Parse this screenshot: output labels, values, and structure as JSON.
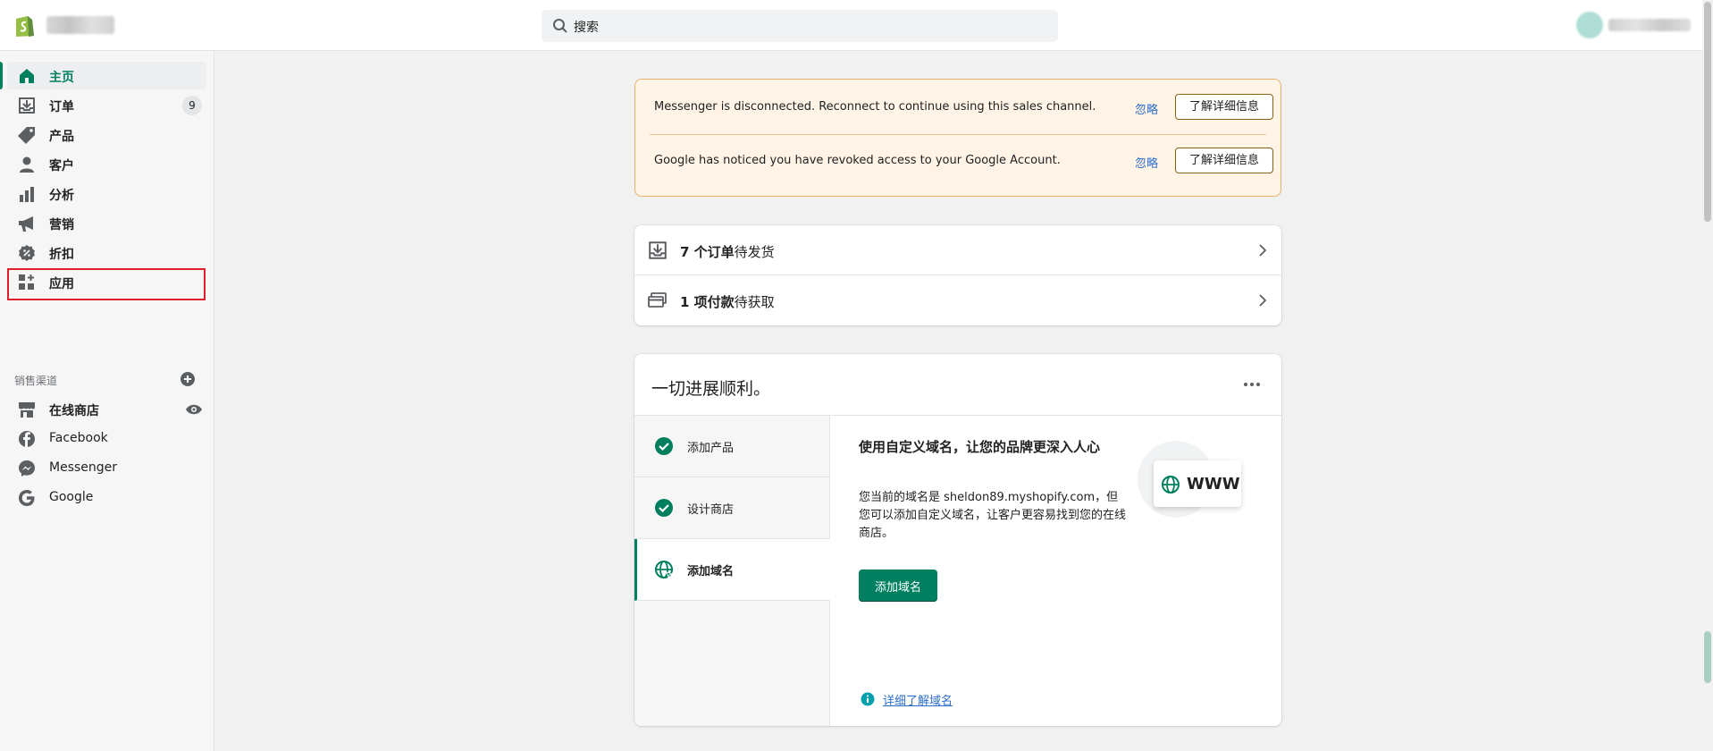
{
  "search": {
    "placeholder": "搜索"
  },
  "sidebar": {
    "items": [
      {
        "label": "主页",
        "icon": "home-icon"
      },
      {
        "label": "订单",
        "icon": "orders-icon",
        "badge": "9"
      },
      {
        "label": "产品",
        "icon": "tag-icon"
      },
      {
        "label": "客户",
        "icon": "person-icon"
      },
      {
        "label": "分析",
        "icon": "bar-chart-icon"
      },
      {
        "label": "营销",
        "icon": "megaphone-icon"
      },
      {
        "label": "折扣",
        "icon": "discount-icon"
      },
      {
        "label": "应用",
        "icon": "apps-icon"
      }
    ],
    "sales_channels_title": "销售渠道",
    "channels": [
      {
        "label": "在线商店",
        "icon": "store-icon"
      },
      {
        "label": "Facebook",
        "icon": "facebook-icon"
      },
      {
        "label": "Messenger",
        "icon": "messenger-icon"
      },
      {
        "label": "Google",
        "icon": "google-icon"
      }
    ]
  },
  "alerts": [
    {
      "text": "Messenger is disconnected. Reconnect to continue using this sales channel.",
      "ignore": "忽略",
      "button": "了解详细信息"
    },
    {
      "text": "Google has noticed you have revoked access to your Google Account.",
      "ignore": "忽略",
      "button": "了解详细信息"
    }
  ],
  "tasks": [
    {
      "count": "7 个订单",
      "suffix": "待发货"
    },
    {
      "count": "1 项付款",
      "suffix": "待获取"
    }
  ],
  "setup": {
    "title": "一切进展顺利。",
    "steps": [
      {
        "label": "添加产品",
        "done": true
      },
      {
        "label": "设计商店",
        "done": true
      },
      {
        "label": "添加域名",
        "done": false
      }
    ],
    "detail_title": "使用自定义域名，让您的品牌更深入人心",
    "detail_desc": "您当前的域名是 sheldon89.myshopify.com，但您可以添加自定义域名，让客户更容易找到您的在线商店。",
    "button": "添加域名",
    "www": "WWW",
    "learn_more": "详细了解域名"
  },
  "colors": {
    "brand": "#008060",
    "alert_bg": "#fff4e5",
    "link": "#2c6ecb",
    "highlight": "#e0212b"
  }
}
